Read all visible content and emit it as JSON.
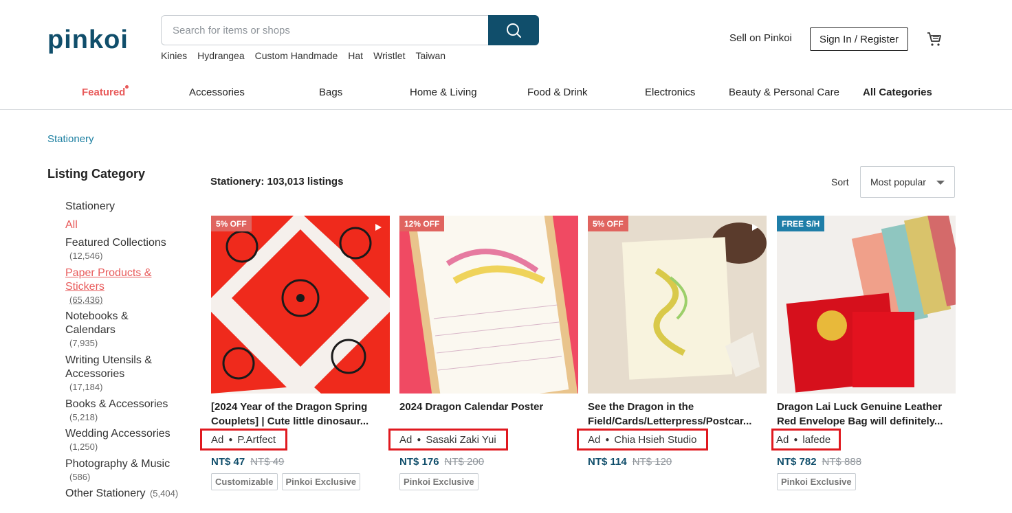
{
  "brand": {
    "name": "pinkoi",
    "color": "#104e6b"
  },
  "search": {
    "placeholder": "Search for items or shops",
    "hot_keywords": [
      "Kinies",
      "Hydrangea",
      "Custom Handmade",
      "Hat",
      "Wristlet",
      "Taiwan"
    ]
  },
  "header": {
    "sell_label": "Sell on Pinkoi",
    "signin_label": "Sign In / Register"
  },
  "nav": [
    "Featured",
    "Accessories",
    "Bags",
    "Home & Living",
    "Food & Drink",
    "Electronics",
    "Beauty & Personal Care",
    "All Categories"
  ],
  "breadcrumb": "Stationery",
  "sidebar": {
    "title": "Listing Category",
    "root": "Stationery",
    "all_label": "All",
    "categories": [
      {
        "label": "Featured Collections",
        "count": "(12,546)"
      },
      {
        "label": "Paper Products & Stickers",
        "count": "(65,436)"
      },
      {
        "label": "Notebooks & Calendars",
        "count": "(7,935)"
      },
      {
        "label": "Writing Utensils & Accessories",
        "count": "(17,184)"
      },
      {
        "label": "Books & Accessories",
        "count": "(5,218)"
      },
      {
        "label": "Wedding Accessories",
        "count": "(1,250)"
      },
      {
        "label": "Photography & Music",
        "count": "(586)"
      },
      {
        "label": "Other Stationery",
        "count": "(5,404)"
      }
    ]
  },
  "listing": {
    "count_label": "Stationery: 103,013 listings",
    "sort_label": "Sort",
    "sort_value": "Most popular"
  },
  "products": [
    {
      "badge": "5% OFF",
      "title": "[2024 Year of the Dragon Spring Couplets] | Cute little dinosaur...",
      "ad": "Ad",
      "shop": "P.Artfect",
      "price": "NT$ 47",
      "old_price": "NT$ 49",
      "tags": [
        "Customizable",
        "Pinkoi Exclusive"
      ]
    },
    {
      "badge": "12% OFF",
      "title": "2024 Dragon Calendar Poster",
      "ad": "Ad",
      "shop": "Sasaki Zaki Yui",
      "price": "NT$ 176",
      "old_price": "NT$ 200",
      "tags": [
        "Pinkoi Exclusive"
      ]
    },
    {
      "badge": "5% OFF",
      "title": "See the Dragon in the Field/Cards/Letterpress/Postcar...",
      "ad": "Ad",
      "shop": "Chia Hsieh Studio",
      "price": "NT$ 114",
      "old_price": "NT$ 120",
      "tags": []
    },
    {
      "badge": "FREE S/H",
      "title": "Dragon Lai Luck Genuine Leather Red Envelope Bag will definitely...",
      "ad": "Ad",
      "shop": "lafede",
      "price": "NT$ 782",
      "old_price": "NT$ 888",
      "tags": [
        "Pinkoi Exclusive"
      ]
    }
  ]
}
